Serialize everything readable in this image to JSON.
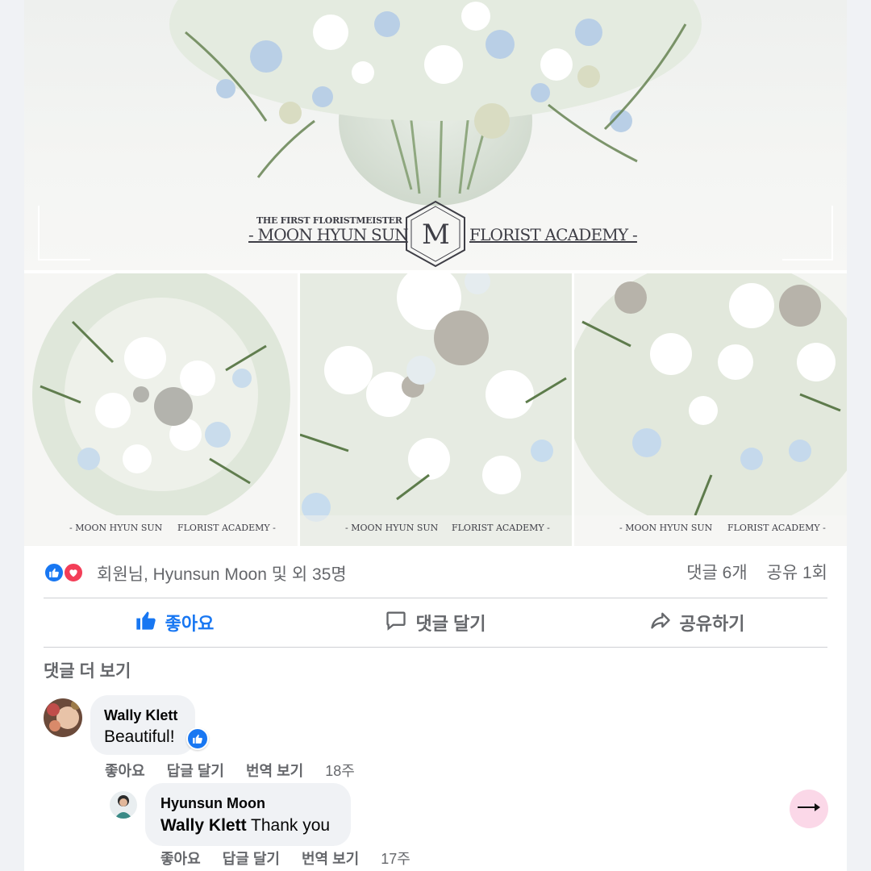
{
  "post": {
    "hero_image": {
      "alt": "flower arrangement in glass bowl",
      "watermark": {
        "line1": "THE FIRST FLORISTMEISTER",
        "left": "- MOON HYUN SUN",
        "right": "FLORIST ACADEMY -",
        "monogram": "M"
      }
    },
    "thumbnails": [
      {
        "alt": "white winter bouquet with ornaments",
        "watermark_left": "- MOON HYUN SUN",
        "watermark_right": "FLORIST ACADEMY -"
      },
      {
        "alt": "close-up of winter bouquet with silver ornaments",
        "watermark_left": "- MOON HYUN SUN",
        "watermark_right": "FLORIST ACADEMY -"
      },
      {
        "alt": "winter bouquet side view",
        "watermark_left": "- MOON HYUN SUN",
        "watermark_right": "FLORIST ACADEMY -"
      }
    ]
  },
  "stats": {
    "reaction_icons": [
      "like-icon",
      "love-icon"
    ],
    "reactions_text": "회원님, Hyunsun Moon 및 외 35명",
    "comments": "댓글 6개",
    "shares": "공유 1회"
  },
  "actions": {
    "like": "좋아요",
    "comment": "댓글 달기",
    "share": "공유하기",
    "like_color": "#1877f2"
  },
  "comments_section": {
    "view_more": "댓글 더 보기",
    "comments": [
      {
        "author": "Wally Klett",
        "text": "Beautiful!",
        "reaction": "like-icon",
        "actions": [
          "좋아요",
          "답글 달기",
          "번역 보기"
        ],
        "time": "18주"
      }
    ],
    "reply": {
      "author": "Hyunsun Moon",
      "mention": "Wally Klett",
      "text": "Thank you",
      "actions": [
        "좋아요",
        "답글 달기",
        "번역 보기"
      ],
      "time": "17주"
    }
  },
  "colors": {
    "accent": "#1877f2",
    "love": "#f33e58",
    "muted": "#65676b",
    "bubble": "#f0f2f5"
  }
}
